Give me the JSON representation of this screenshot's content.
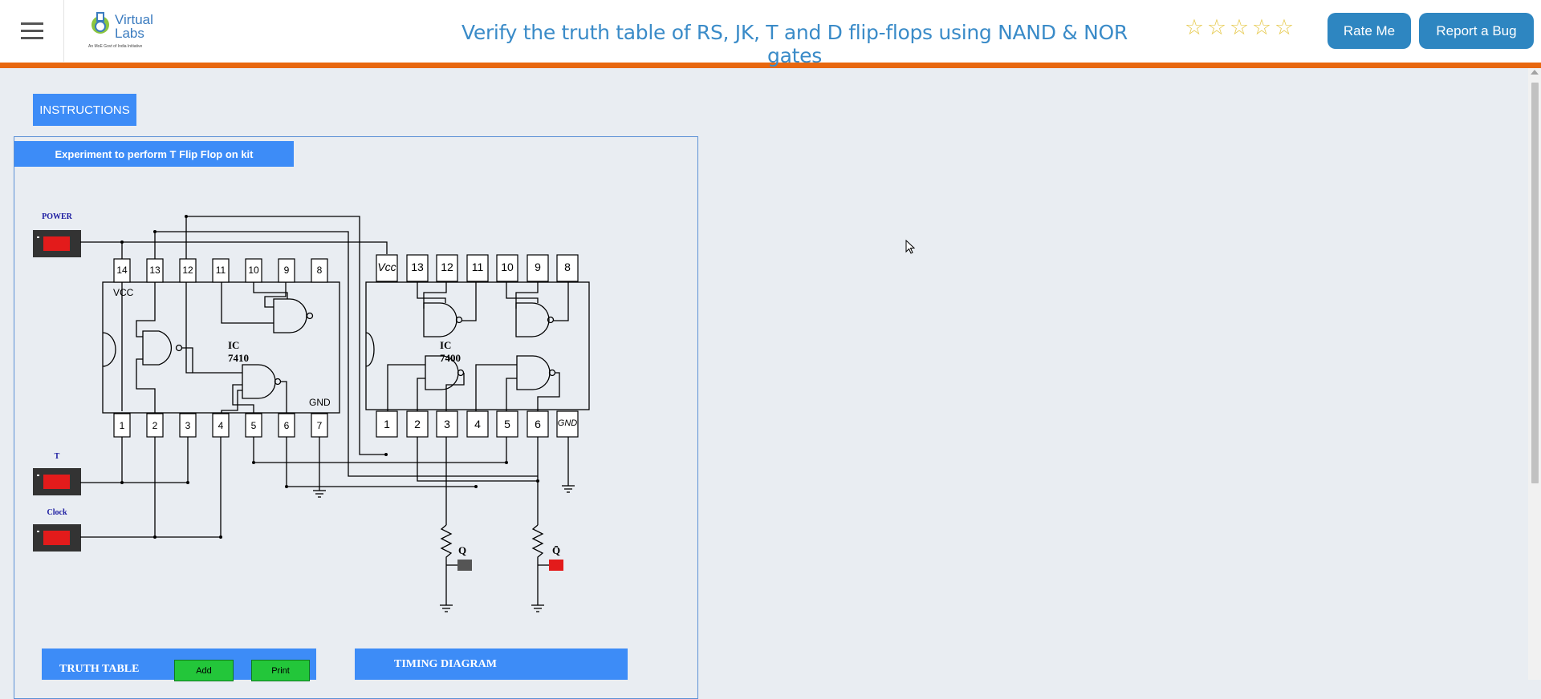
{
  "header": {
    "title": "Verify the truth table of RS, JK, T and D flip-flops using NAND & NOR gates",
    "logo_text": "Virtual Labs",
    "logo_tagline": "An MoE Govt of India Initiative",
    "rating_stars": [
      "☆",
      "☆",
      "☆",
      "☆",
      "☆"
    ],
    "rate_label": "Rate Me",
    "bug_label": "Report a Bug",
    "accent": "#e8670f",
    "title_color": "#3a8bc8"
  },
  "main": {
    "instructions_label": "INSTRUCTIONS",
    "experiment_title": "Experiment to perform T Flip Flop on kit",
    "switches": {
      "power": "POWER",
      "t": "T",
      "clock": "Clock"
    },
    "ic1": {
      "name": "IC 7410",
      "vcc": "VCC",
      "gnd": "GND",
      "top_pins": [
        "14",
        "13",
        "12",
        "11",
        "10",
        "9",
        "8"
      ],
      "bottom_pins": [
        "1",
        "2",
        "3",
        "4",
        "5",
        "6",
        "7"
      ]
    },
    "ic2": {
      "name": "IC 7400",
      "top_pins": [
        "Vcc",
        "13",
        "12",
        "11",
        "10",
        "9",
        "8"
      ],
      "bottom_pins": [
        "1",
        "2",
        "3",
        "4",
        "5",
        "6",
        "GND"
      ]
    },
    "outputs": {
      "q": "Q",
      "q_bar": "Q̄"
    },
    "truth_table": {
      "title": "TRUTH TABLE",
      "add_label": "Add",
      "print_label": "Print"
    },
    "timing": {
      "title": "TIMING DIAGRAM"
    }
  }
}
